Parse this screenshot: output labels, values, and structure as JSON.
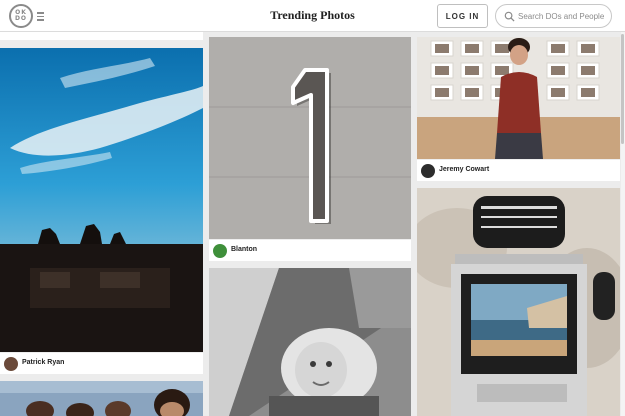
{
  "header": {
    "logo_text": "OKDO",
    "title": "Trending Photos",
    "login_label": "LOG IN",
    "search_placeholder": "Search DOs and People"
  },
  "photos": [
    {
      "author": "Patrick Ryan",
      "subject": "rooftop silhouettes at sunset"
    },
    {
      "author": "Blanton",
      "subject": "number 1 on concrete wall"
    },
    {
      "author": "",
      "subject": "black and white child portrait"
    },
    {
      "author": "Jeremy Cowart",
      "subject": "woman sitting in front of photo wall"
    },
    {
      "author": "",
      "subject": "medium format camera over desk"
    },
    {
      "author": "",
      "subject": "group of smiling people"
    }
  ],
  "icons": {
    "logo": "okdo-logo-icon",
    "menu": "hamburger-menu-icon",
    "search": "search-icon"
  },
  "colors": {
    "background": "#ececec",
    "header": "#ffffff",
    "text": "#222222"
  }
}
